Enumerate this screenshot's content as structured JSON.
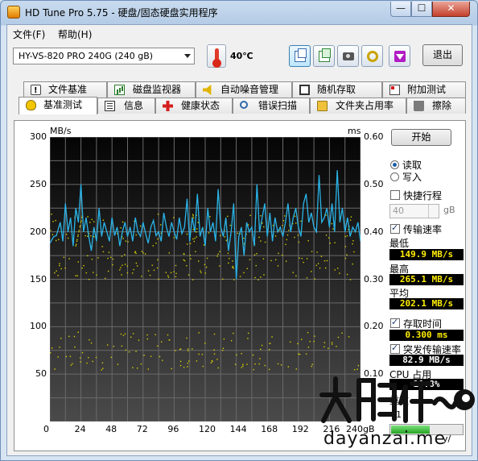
{
  "window": {
    "title": "HD Tune Pro 5.75 - 硬盘/固态硬盘实用程序",
    "min": "—",
    "max": "☐",
    "close": "✕"
  },
  "menu": {
    "items": [
      "文件(F)",
      "帮助(H)"
    ]
  },
  "toolbar": {
    "drive": "HY-VS-820 PRO 240G (240 gB)",
    "temperature": "40℃",
    "exit_label": "退出",
    "buttons": [
      "copy-icon",
      "copy-green-icon",
      "camera-icon",
      "wrench-icon",
      "download-icon"
    ]
  },
  "tabs_top": [
    "文件基准",
    "磁盘监视器",
    "自动噪音管理",
    "随机存取",
    "附加测试"
  ],
  "tabs_bottom": [
    "基准测试",
    "信息",
    "健康状态",
    "错误扫描",
    "文件夹占用率",
    "擦除"
  ],
  "active_tab": "基准测试",
  "side": {
    "start_label": "开始",
    "read_label": "读取",
    "write_label": "写入",
    "quick_label": "快捷行程",
    "quick_value": "40",
    "quick_unit": "gB",
    "transfer_label": "传输速率",
    "min_label": "最低",
    "min_value": "149.9 MB/s",
    "max_label": "最高",
    "max_value": "265.1 MB/s",
    "avg_label": "平均",
    "avg_value": "202.1 MB/s",
    "access_label": "存取时间",
    "access_value": "0.300 ms",
    "burst_label": "突发传输速率",
    "burst_value": "82.9 MB/s",
    "cpu_label": "CPU 占用",
    "cpu_value": "10.8%",
    "partial_label": "重数",
    "partial_value": "1",
    "partial_suffix": "y/",
    "progress_fraction": 0.55
  },
  "watermark": {
    "chars": "大眼仔~旭",
    "site": "dayanzai.me"
  },
  "chart_data": {
    "type": "line",
    "left_unit": "MB/s",
    "right_unit": "ms",
    "x_ticks": [
      "0",
      "24",
      "48",
      "72",
      "96",
      "120",
      "144",
      "168",
      "192",
      "216",
      "240gB"
    ],
    "y_ticks": [
      "300",
      "250",
      "200",
      "150",
      "100",
      "50"
    ],
    "y2_ticks": [
      "0.60",
      "0.50",
      "0.40",
      "0.30",
      "0.20",
      "0.10"
    ],
    "xlim": [
      0,
      240
    ],
    "ylim": [
      0,
      300
    ],
    "y2lim": [
      0,
      0.6
    ],
    "series": [
      {
        "kind": "transfer",
        "color": "#2ab4e8",
        "x": [
          0,
          3,
          5,
          8,
          10,
          12,
          14,
          16,
          18,
          20,
          22,
          24,
          26,
          28,
          30,
          32,
          34,
          36,
          38,
          40,
          42,
          44,
          46,
          48,
          50,
          52,
          54,
          56,
          58,
          60,
          62,
          64,
          66,
          68,
          70,
          72,
          74,
          76,
          78,
          80,
          82,
          84,
          86,
          88,
          90,
          92,
          94,
          96,
          98,
          100,
          102,
          104,
          106,
          108,
          110,
          112,
          114,
          116,
          118,
          120,
          122,
          124,
          126,
          128,
          130,
          132,
          134,
          136,
          138,
          140,
          142,
          144,
          146,
          148,
          150,
          152,
          154,
          156,
          158,
          160,
          162,
          164,
          166,
          168,
          170,
          172,
          174,
          176,
          178,
          180,
          182,
          184,
          186,
          188,
          190,
          192,
          194,
          196,
          198,
          200,
          202,
          204,
          206,
          208,
          210,
          212,
          214,
          216,
          218,
          220,
          222,
          224,
          226,
          228,
          230,
          232,
          234,
          236,
          238,
          240
        ],
        "y": [
          188,
          195,
          196,
          210,
          190,
          230,
          200,
          215,
          185,
          225,
          210,
          250,
          200,
          215,
          195,
          180,
          205,
          190,
          225,
          195,
          210,
          200,
          190,
          215,
          196,
          205,
          185,
          200,
          210,
          195,
          205,
          190,
          215,
          200,
          195,
          210,
          198,
          188,
          205,
          212,
          196,
          200,
          190,
          220,
          205,
          195,
          210,
          200,
          192,
          215,
          198,
          205,
          235,
          190,
          215,
          200,
          240,
          195,
          205,
          185,
          225,
          200,
          210,
          190,
          245,
          205,
          195,
          215,
          180,
          200,
          230,
          150,
          195,
          205,
          175,
          210,
          200,
          205,
          185,
          250,
          200,
          215,
          230,
          195,
          220,
          190,
          215,
          200,
          205,
          195,
          210,
          230,
          200,
          215,
          225,
          205,
          195,
          230,
          240,
          210,
          220,
          205,
          200,
          260,
          210,
          215,
          225,
          205,
          230,
          200,
          265,
          210,
          225,
          200,
          215,
          195,
          205,
          200,
          210,
          190
        ]
      }
    ]
  }
}
